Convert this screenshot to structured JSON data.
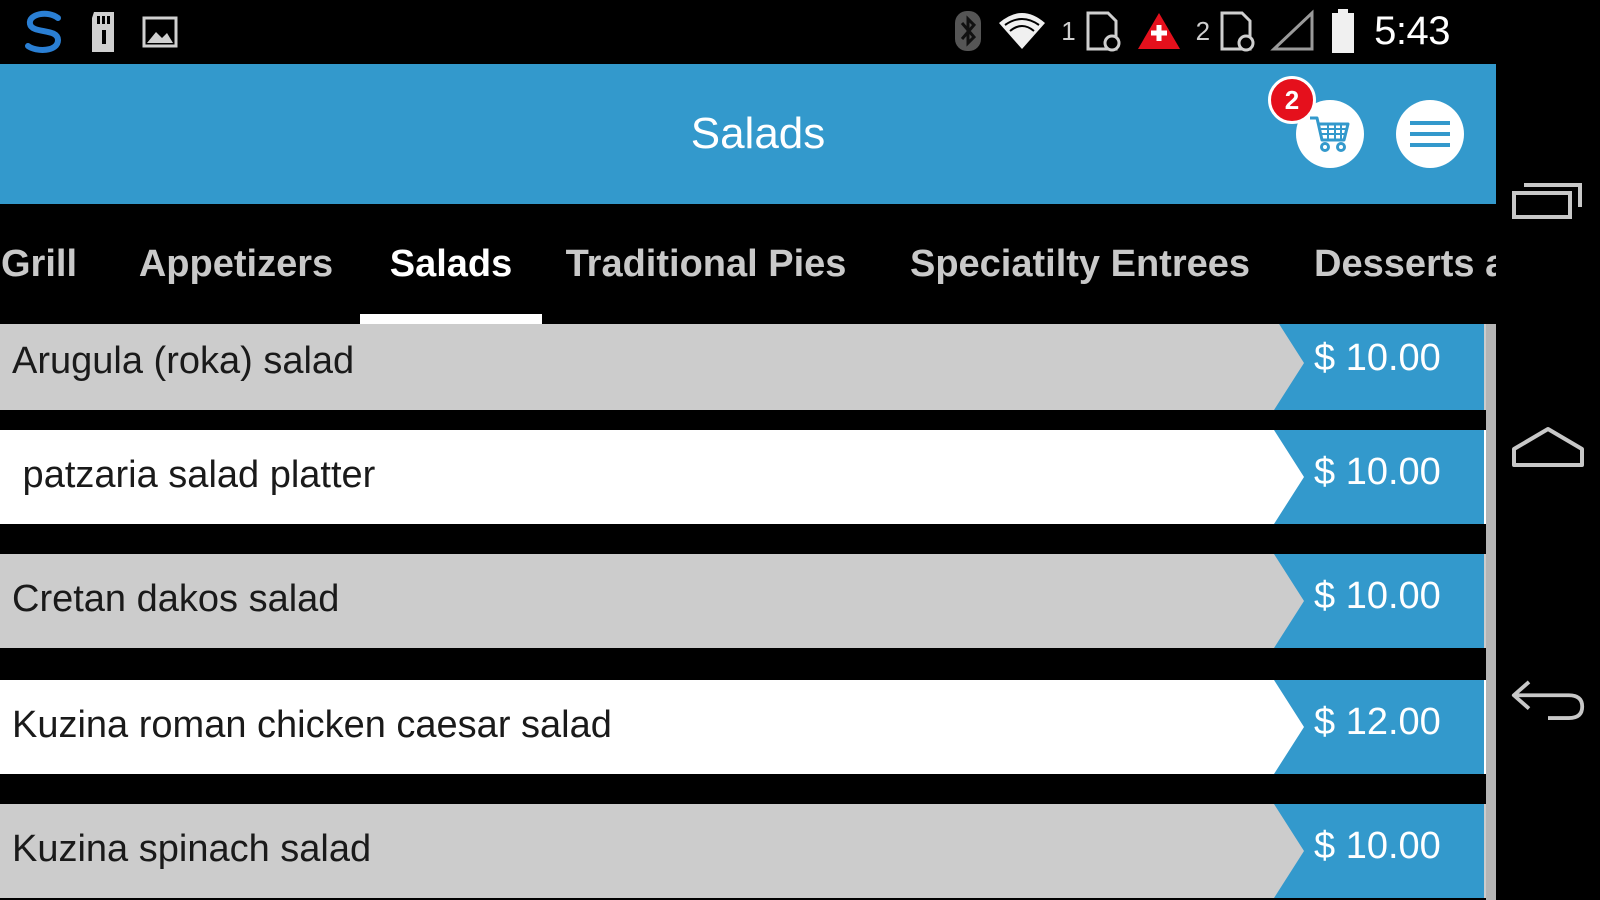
{
  "status_bar": {
    "sim1_label": "1",
    "sim2_label": "2",
    "time": "5:43",
    "icons": [
      "app-s-logo-icon",
      "sd-card-icon",
      "image-icon",
      "bluetooth-icon",
      "wifi-icon",
      "sim-card-icon",
      "alert-triangle-icon",
      "signal-icon",
      "battery-icon"
    ]
  },
  "header": {
    "title": "Salads",
    "cart_count": "2",
    "cart_icon": "cart-icon",
    "menu_icon": "hamburger-menu-icon",
    "accent_color": "#3399cc",
    "badge_color": "#e5101c"
  },
  "tabs": [
    {
      "label": "Grill",
      "active": false
    },
    {
      "label": "Appetizers",
      "active": false
    },
    {
      "label": "Salads",
      "active": true
    },
    {
      "label": "Traditional Pies",
      "active": false
    },
    {
      "label": "Speciatilty Entrees",
      "active": false
    },
    {
      "label": "Desserts a",
      "active": false
    }
  ],
  "menu_items": [
    {
      "name": "Arugula (roka) salad",
      "price": "$ 10.00"
    },
    {
      "name": " patzaria salad platter",
      "price": "$ 10.00"
    },
    {
      "name": "Cretan dakos salad",
      "price": "$ 10.00"
    },
    {
      "name": "Kuzina roman chicken caesar salad",
      "price": "$ 12.00"
    },
    {
      "name": "Kuzina spinach salad",
      "price": "$ 10.00"
    }
  ],
  "nav_bar": {
    "icons": [
      "recent-apps-icon",
      "home-icon",
      "back-icon"
    ]
  }
}
